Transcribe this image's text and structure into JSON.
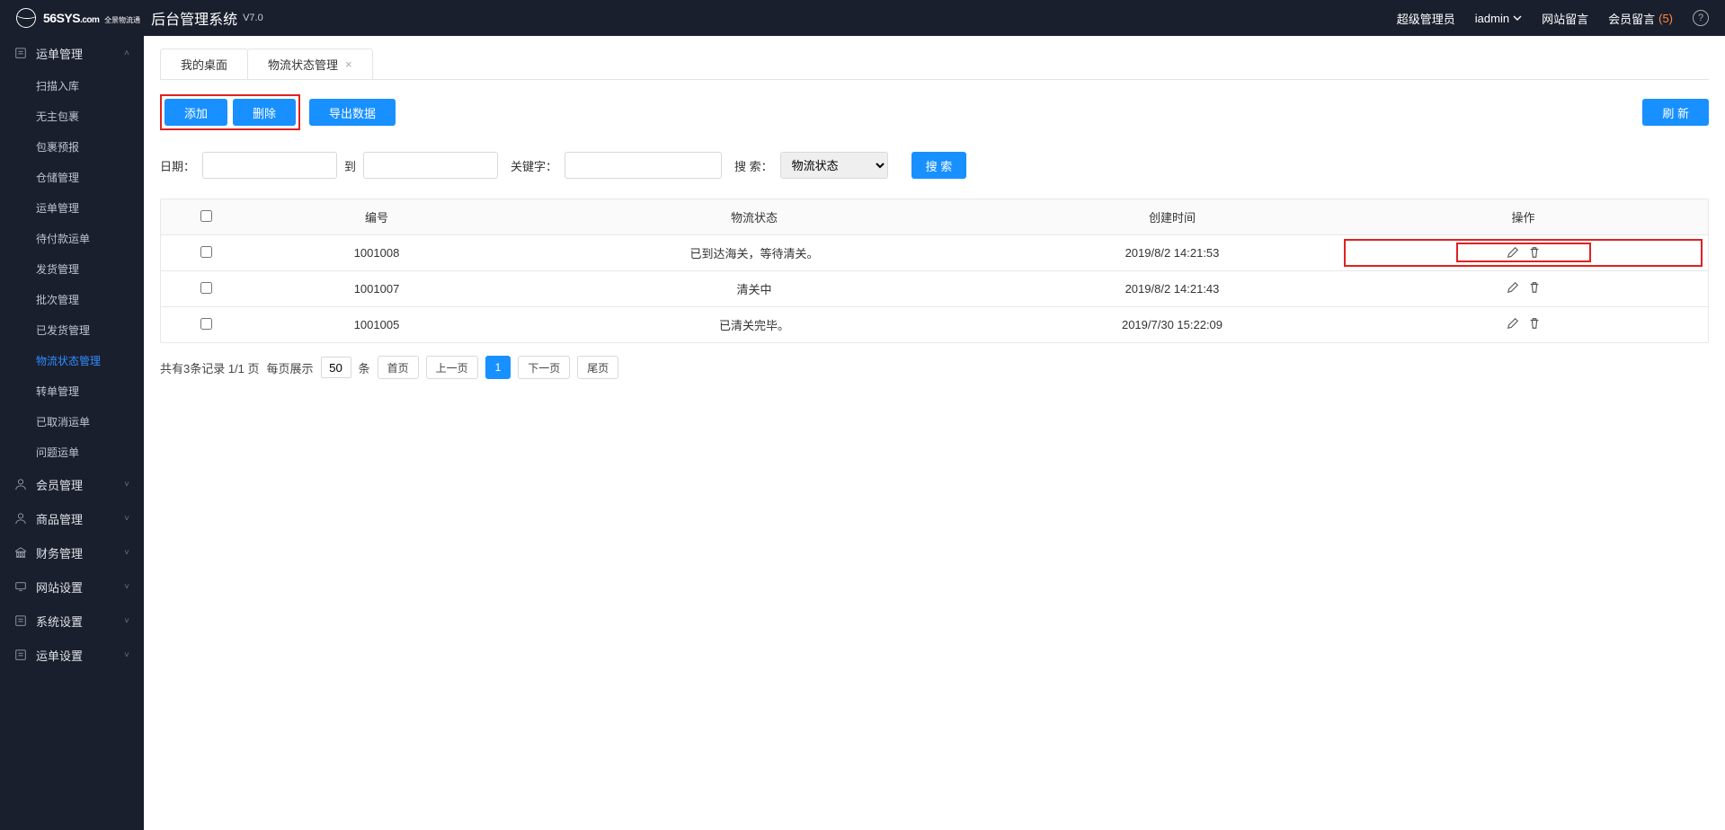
{
  "header": {
    "logo_main": "56SYS",
    "logo_dot": ".com",
    "logo_sub": "全景物流通",
    "title": "后台管理系统",
    "version": "V7.0",
    "role": "超级管理员",
    "user": "iadmin",
    "site_msg": "网站留言",
    "member_msg": "会员留言",
    "member_msg_count": "(5)"
  },
  "sidebar": [
    {
      "icon": "doc",
      "label": "运单管理",
      "expanded": true,
      "arrow": "up",
      "items": [
        {
          "label": "扫描入库"
        },
        {
          "label": "无主包裹"
        },
        {
          "label": "包裹预报"
        },
        {
          "label": "仓储管理"
        },
        {
          "label": "运单管理"
        },
        {
          "label": "待付款运单"
        },
        {
          "label": "发货管理"
        },
        {
          "label": "批次管理"
        },
        {
          "label": "已发货管理"
        },
        {
          "label": "物流状态管理",
          "active": true
        },
        {
          "label": "转单管理"
        },
        {
          "label": "已取消运单"
        },
        {
          "label": "问题运单"
        }
      ]
    },
    {
      "icon": "user",
      "label": "会员管理",
      "arrow": "down"
    },
    {
      "icon": "user",
      "label": "商品管理",
      "arrow": "down"
    },
    {
      "icon": "bank",
      "label": "财务管理",
      "arrow": "down"
    },
    {
      "icon": "monitor",
      "label": "网站设置",
      "arrow": "down"
    },
    {
      "icon": "doc",
      "label": "系统设置",
      "arrow": "down"
    },
    {
      "icon": "doc",
      "label": "运单设置",
      "arrow": "down"
    }
  ],
  "tabs": [
    {
      "label": "我的桌面",
      "closable": false
    },
    {
      "label": "物流状态管理",
      "closable": true
    }
  ],
  "buttons": {
    "add": "添加",
    "delete": "删除",
    "export": "导出数据",
    "refresh": "刷 新",
    "search": "搜 索"
  },
  "filters": {
    "date_label": "日期：",
    "to": "到",
    "kw_label": "关键字：",
    "search_label": "搜 索：",
    "search_option": "物流状态"
  },
  "table": {
    "headers": [
      "",
      "编号",
      "物流状态",
      "创建时间",
      "操作"
    ],
    "rows": [
      {
        "code": "1001008",
        "status": "已到达海关，等待清关。",
        "time": "2019/8/2 14:21:53",
        "highlight": true
      },
      {
        "code": "1001007",
        "status": "清关中",
        "time": "2019/8/2 14:21:43"
      },
      {
        "code": "1001005",
        "status": "已清关完毕。",
        "time": "2019/7/30 15:22:09"
      }
    ]
  },
  "pager": {
    "summary": "共有3条记录  1/1 页",
    "per_label": "每页展示",
    "per_value": "50",
    "per_unit": "条",
    "first": "首页",
    "prev": "上一页",
    "page": "1",
    "next": "下一页",
    "last": "尾页"
  }
}
